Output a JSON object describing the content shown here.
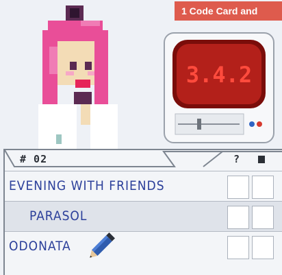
{
  "banner": {
    "text": "1 Code Card and"
  },
  "monitor": {
    "code": "3.4.2"
  },
  "card": {
    "number": "# 02",
    "header_question": "?",
    "rows": [
      {
        "label": "EVENING WITH FRIENDS"
      },
      {
        "label": "PARASOL"
      },
      {
        "label": "ODONATA"
      }
    ]
  },
  "colors": {
    "banner": "#de5b4d",
    "text": "#2b3f9a",
    "screen": "#b3201a"
  },
  "icons": [
    "pixel-character",
    "monitor-icon",
    "pencil-icon",
    "card-icon"
  ]
}
